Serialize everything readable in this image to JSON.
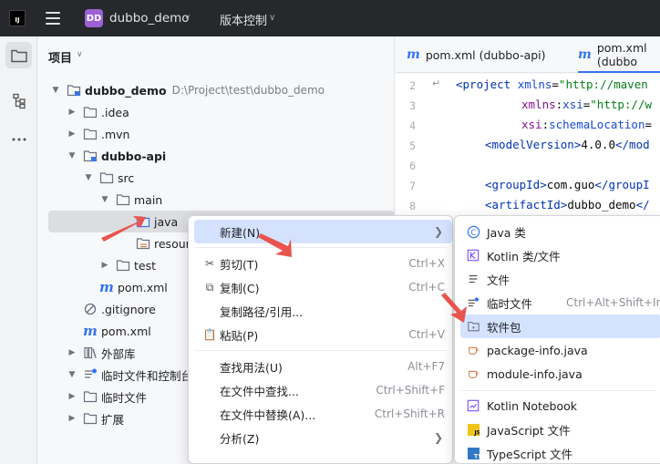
{
  "titlebar": {
    "logo_text": "IJ",
    "project_badge": "DD",
    "project_name": "dubbo_demo",
    "vcs_label": "版本控制"
  },
  "panel": {
    "title": "项目",
    "tree": [
      {
        "label": "dubbo_demo",
        "path": "D:\\Project\\test\\dubbo_demo",
        "bold": true
      },
      {
        "label": ".idea"
      },
      {
        "label": ".mvn"
      },
      {
        "label": "dubbo-api",
        "bold": true
      },
      {
        "label": "src"
      },
      {
        "label": "main"
      },
      {
        "label": "java"
      },
      {
        "label": "resour"
      },
      {
        "label": "test"
      },
      {
        "label": "pom.xml"
      },
      {
        "label": ".gitignore"
      },
      {
        "label": "pom.xml"
      },
      {
        "label": "外部库"
      },
      {
        "label": "临时文件和控制台"
      },
      {
        "label": "临时文件"
      },
      {
        "label": "扩展"
      }
    ]
  },
  "editor": {
    "tabs": [
      {
        "label": "pom.xml (dubbo-api)"
      },
      {
        "label": "pom.xml (dubbo"
      }
    ],
    "line_numbers": [
      "2",
      "3",
      "4",
      "5",
      "6",
      "7",
      "8"
    ]
  },
  "context_menu": {
    "items": [
      {
        "label": "新建(N)",
        "shortcut": ""
      },
      {
        "label": "剪切(T)",
        "shortcut": "Ctrl+X"
      },
      {
        "label": "复制(C)",
        "shortcut": "Ctrl+C"
      },
      {
        "label": "复制路径/引用...",
        "shortcut": ""
      },
      {
        "label": "粘贴(P)",
        "shortcut": "Ctrl+V"
      },
      {
        "label": "查找用法(U)",
        "shortcut": "Alt+F7"
      },
      {
        "label": "在文件中查找...",
        "shortcut": "Ctrl+Shift+F"
      },
      {
        "label": "在文件中替换(A)...",
        "shortcut": "Ctrl+Shift+R"
      },
      {
        "label": "分析(Z)",
        "shortcut": ""
      }
    ]
  },
  "submenu": {
    "items": [
      {
        "label": "Java 类",
        "shortcut": ""
      },
      {
        "label": "Kotlin 类/文件",
        "shortcut": ""
      },
      {
        "label": "文件",
        "shortcut": ""
      },
      {
        "label": "临时文件",
        "shortcut": "Ctrl+Alt+Shift+Ins"
      },
      {
        "label": "软件包",
        "shortcut": ""
      },
      {
        "label": "package-info.java",
        "shortcut": ""
      },
      {
        "label": "module-info.java",
        "shortcut": ""
      },
      {
        "label": "Kotlin Notebook",
        "shortcut": ""
      },
      {
        "label": "JavaScript 文件",
        "shortcut": ""
      },
      {
        "label": "TypeScript 文件",
        "shortcut": ""
      }
    ]
  },
  "colors": {
    "accent": "#3574f0",
    "selection": "#d4e2ff",
    "arrow": "#e8554e"
  }
}
